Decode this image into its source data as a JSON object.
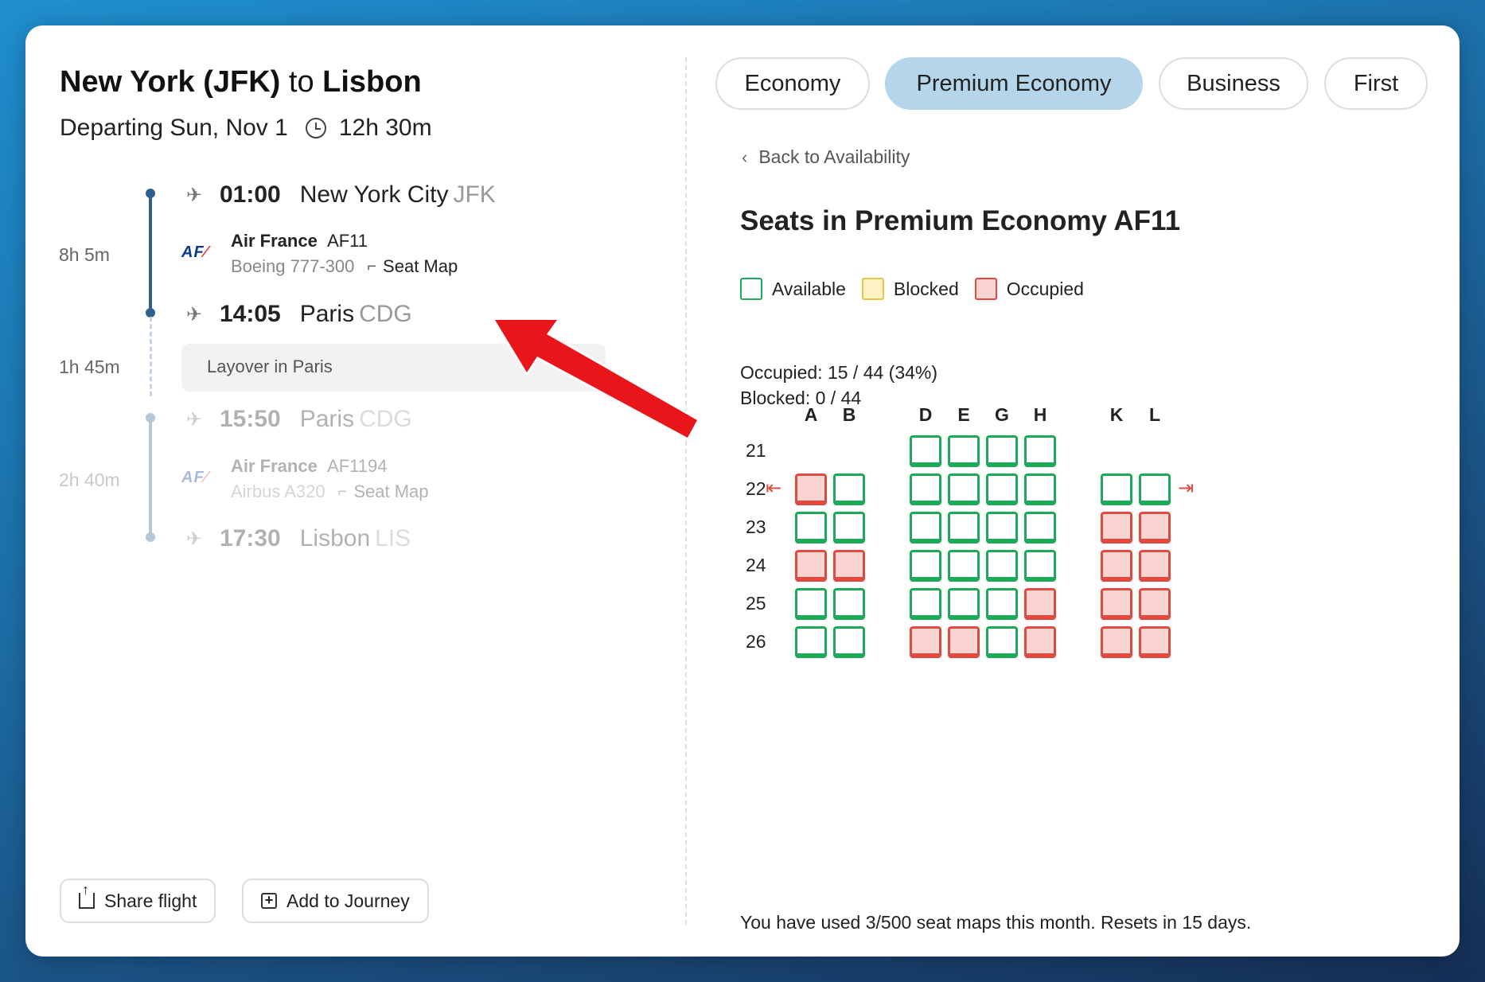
{
  "header": {
    "origin": "New York (JFK)",
    "to_word": "to",
    "destination": "Lisbon",
    "departing": "Departing Sun, Nov 1",
    "duration": "12h 30m"
  },
  "itinerary": {
    "segment1": {
      "flight_duration": "8h 5m",
      "dep_time": "01:00",
      "dep_city": "New York City",
      "dep_code": "JFK",
      "airline": "Air France",
      "flight_no": "AF11",
      "aircraft": "Boeing 777-300",
      "seat_map": "Seat Map",
      "arr_time": "14:05",
      "arr_city": "Paris",
      "arr_code": "CDG"
    },
    "layover": {
      "duration": "1h 45m",
      "label": "Layover in Paris"
    },
    "segment2": {
      "flight_duration": "2h 40m",
      "dep_time": "15:50",
      "dep_city": "Paris",
      "dep_code": "CDG",
      "airline": "Air France",
      "flight_no": "AF1194",
      "aircraft": "Airbus A320",
      "seat_map": "Seat Map",
      "arr_time": "17:30",
      "arr_city": "Lisbon",
      "arr_code": "LIS"
    },
    "logo_text": "AF"
  },
  "actions": {
    "share": "Share flight",
    "add": "Add to Journey"
  },
  "tabs": [
    {
      "label": "Economy",
      "active": false
    },
    {
      "label": "Premium Economy",
      "active": true
    },
    {
      "label": "Business",
      "active": false
    },
    {
      "label": "First",
      "active": false
    }
  ],
  "back": "Back to Availability",
  "seats_title": "Seats in Premium Economy AF11",
  "legend": {
    "available": "Available",
    "blocked": "Blocked",
    "occupied": "Occupied"
  },
  "stats": {
    "occupied": "Occupied: 15 / 44 (34%)",
    "blocked": "Blocked: 0 / 44"
  },
  "seat_columns": [
    "A",
    "B",
    "D",
    "E",
    "G",
    "H",
    "K",
    "L"
  ],
  "seat_rows": [
    {
      "row": "21",
      "seats": {
        "D": "available",
        "E": "available",
        "G": "available",
        "H": "available"
      }
    },
    {
      "row": "22",
      "exit": true,
      "seats": {
        "A": "occupied",
        "B": "available",
        "D": "available",
        "E": "available",
        "G": "available",
        "H": "available",
        "K": "available",
        "L": "available"
      }
    },
    {
      "row": "23",
      "seats": {
        "A": "available",
        "B": "available",
        "D": "available",
        "E": "available",
        "G": "available",
        "H": "available",
        "K": "occupied",
        "L": "occupied"
      }
    },
    {
      "row": "24",
      "seats": {
        "A": "occupied",
        "B": "occupied",
        "D": "available",
        "E": "available",
        "G": "available",
        "H": "available",
        "K": "occupied",
        "L": "occupied"
      }
    },
    {
      "row": "25",
      "seats": {
        "A": "available",
        "B": "available",
        "D": "available",
        "E": "available",
        "G": "available",
        "H": "occupied",
        "K": "occupied",
        "L": "occupied"
      }
    },
    {
      "row": "26",
      "seats": {
        "A": "available",
        "B": "available",
        "D": "occupied",
        "E": "occupied",
        "G": "available",
        "H": "occupied",
        "K": "occupied",
        "L": "occupied"
      }
    }
  ],
  "usage": "You have used 3/500 seat maps this month. Resets in 15 days.",
  "colors": {
    "available": "#1faa59",
    "blocked": "#e8c54a",
    "occupied": "#e04a3f",
    "active_tab": "#b5d5ea",
    "timeline": "#2f5f8f",
    "annotation_arrow": "#e8151b"
  }
}
